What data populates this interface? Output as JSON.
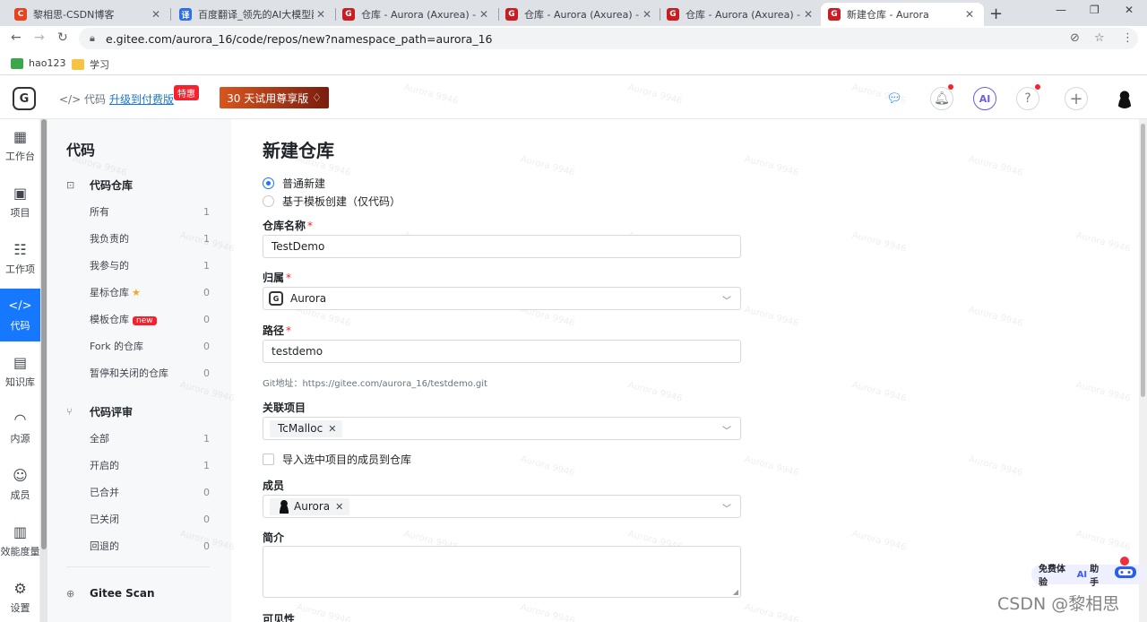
{
  "browser": {
    "tabs": [
      {
        "title": "黎相思-CSDN博客",
        "icon": "C",
        "color": "#e8421e"
      },
      {
        "title": "百度翻译_领先的AI大模型翻译",
        "icon": "译",
        "color": "#2e6fe8"
      },
      {
        "title": "仓库 - Aurora (Axurea) - Gi",
        "icon": "G",
        "color": "#c71d23"
      },
      {
        "title": "仓库 - Aurora (Axurea) - Gi",
        "icon": "G",
        "color": "#c71d23"
      },
      {
        "title": "仓库 - Aurora (Axurea) - Gi",
        "icon": "G",
        "color": "#c71d23"
      },
      {
        "title": "新建仓库 - Aurora",
        "icon": "G",
        "color": "#c71d23"
      }
    ],
    "url": "e.gitee.com/aurora_16/code/repos/new?namespace_path=aurora_16",
    "bookmarks": [
      "hao123",
      "学习"
    ]
  },
  "header": {
    "crumb": "代码",
    "upgrade": "升级到付费版",
    "hot": "特惠",
    "trial": "30 天试用尊享版",
    "ai": "AI",
    "help": "?"
  },
  "rail": [
    {
      "label": "工作台",
      "icon": "▦"
    },
    {
      "label": "项目",
      "icon": "▣"
    },
    {
      "label": "工作项",
      "icon": "☷"
    },
    {
      "label": "代码",
      "icon": "</>"
    },
    {
      "label": "知识库",
      "icon": "▤"
    },
    {
      "label": "内源",
      "icon": "◠"
    },
    {
      "label": "成员",
      "icon": "☺"
    },
    {
      "label": "效能度量",
      "icon": "▥"
    },
    {
      "label": "设置",
      "icon": "⚙"
    }
  ],
  "sidebar": {
    "title": "代码",
    "repo_section": "代码仓库",
    "repos": [
      {
        "label": "所有",
        "count": "1"
      },
      {
        "label": "我负责的",
        "count": "1"
      },
      {
        "label": "我参与的",
        "count": "1"
      },
      {
        "label": "星标仓库",
        "count": "0"
      },
      {
        "label": "模板仓库",
        "count": "0"
      },
      {
        "label": "Fork 的仓库",
        "count": "0"
      },
      {
        "label": "暂停和关闭的仓库",
        "count": "0"
      }
    ],
    "new_badge": "new",
    "review_section": "代码评审",
    "reviews": [
      {
        "label": "全部",
        "count": "1"
      },
      {
        "label": "开启的",
        "count": "1"
      },
      {
        "label": "已合并",
        "count": "0"
      },
      {
        "label": "已关闭",
        "count": "0"
      },
      {
        "label": "回退的",
        "count": "0"
      }
    ],
    "scan": "Gitee Scan"
  },
  "form": {
    "title": "新建仓库",
    "radio_normal": "普通新建",
    "radio_template": "基于模板创建（仅代码）",
    "name_label": "仓库名称",
    "name_value": "TestDemo",
    "owner_label": "归属",
    "owner_value": "Aurora",
    "path_label": "路径",
    "path_value": "testdemo",
    "git_hint": "Git地址：https://gitee.com/aurora_16/testdemo.git",
    "project_label": "关联项目",
    "project_tag": "TcMalloc",
    "import_label": "导入选中项目的成员到仓库",
    "member_label": "成员",
    "member_tag": "Aurora",
    "intro_label": "简介",
    "visibility_label": "可见性",
    "required_mark": "*"
  },
  "watermark": "Aurora 9946",
  "ai_helper": {
    "prefix": "免费体验",
    "ai": "AI",
    "suffix": "助手"
  },
  "csdn_mark": "CSDN @黎相思"
}
